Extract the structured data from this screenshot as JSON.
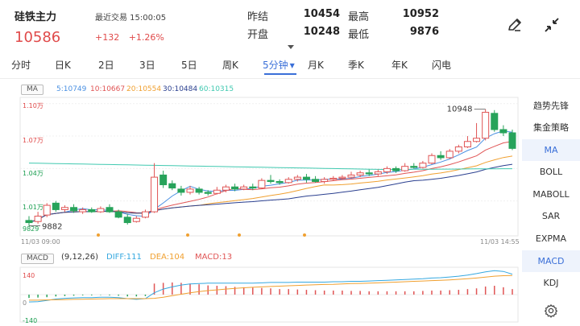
{
  "header": {
    "name": "硅铁主力",
    "last_trade": "最近交易 15:00:05",
    "price": "10586",
    "change": "+132",
    "change_pct": "+1.26%",
    "stats": [
      {
        "label": "昨结",
        "value": "10454"
      },
      {
        "label": "最高",
        "value": "10952"
      },
      {
        "label": "开盘",
        "value": "10248"
      },
      {
        "label": "最低",
        "value": "9876"
      }
    ]
  },
  "tabs": [
    {
      "label": "分时"
    },
    {
      "label": "日K"
    },
    {
      "label": "2日"
    },
    {
      "label": "3日"
    },
    {
      "label": "5日"
    },
    {
      "label": "周K"
    },
    {
      "label": "5分钟"
    },
    {
      "label": "月K"
    },
    {
      "label": "季K"
    },
    {
      "label": "年K"
    },
    {
      "label": "闪电"
    }
  ],
  "active_tab": "5分钟",
  "ma_legend": {
    "badge": "MA",
    "items": [
      {
        "label": "5:10749",
        "color": "#4a90e2"
      },
      {
        "label": "10:10667",
        "color": "#e05555"
      },
      {
        "label": "20:10554",
        "color": "#f0a030"
      },
      {
        "label": "30:10484",
        "color": "#2a3f8f"
      },
      {
        "label": "60:10315",
        "color": "#40c9b0"
      }
    ]
  },
  "price_axis": {
    "ticks": [
      {
        "label": "1.10万",
        "value": 11000,
        "color": "#e04a4a"
      },
      {
        "label": "1.07万",
        "value": 10700,
        "color": "#e04a4a"
      },
      {
        "label": "1.04万",
        "value": 10400,
        "color": "#1a9e50"
      },
      {
        "label": "1.01万",
        "value": 10100,
        "color": "#1a9e50"
      }
    ],
    "low_label": "9829",
    "max_annotation": "10948",
    "min_annotation": "9882",
    "time_start": "11/03 09:00",
    "time_end": "11/03 14:55"
  },
  "macd_legend": {
    "badge": "MACD",
    "params": "(9,12,26)",
    "diff": "DIFF:111",
    "dea": "DEA:104",
    "macd": "MACD:13",
    "colors": {
      "diff": "#35a8e0",
      "dea": "#f0a030",
      "macd": "#e05555"
    }
  },
  "macd_axis": {
    "ticks": [
      "140",
      "0",
      "-140"
    ]
  },
  "sidebar": [
    {
      "label": "趋势先锋"
    },
    {
      "label": "集金策略"
    },
    {
      "label": "MA"
    },
    {
      "label": "BOLL"
    },
    {
      "label": "MABOLL"
    },
    {
      "label": "SAR"
    },
    {
      "label": "EXPMA"
    },
    {
      "label": "MACD"
    },
    {
      "label": "KDJ"
    }
  ],
  "sidebar_active": [
    "MA",
    "MACD"
  ],
  "icons": {
    "edit": "pen-icon",
    "collapse": "collapse-arrows-icon",
    "settings": "gear-icon"
  },
  "chart_data": {
    "type": "candlestick",
    "y_range": [
      9800,
      11050
    ],
    "candles": [
      {
        "o": 9920,
        "c": 9900,
        "h": 9960,
        "l": 9870
      },
      {
        "o": 9910,
        "c": 9960,
        "h": 10000,
        "l": 9890
      },
      {
        "o": 9970,
        "c": 10060,
        "h": 10080,
        "l": 9950
      },
      {
        "o": 10080,
        "c": 10020,
        "h": 10100,
        "l": 10000
      },
      {
        "o": 10020,
        "c": 10040,
        "h": 10060,
        "l": 10000
      },
      {
        "o": 10040,
        "c": 10010,
        "h": 10070,
        "l": 9990
      },
      {
        "o": 10000,
        "c": 10020,
        "h": 10040,
        "l": 9980
      },
      {
        "o": 10020,
        "c": 10000,
        "h": 10040,
        "l": 9990
      },
      {
        "o": 10000,
        "c": 10030,
        "h": 10050,
        "l": 9990
      },
      {
        "o": 10040,
        "c": 10000,
        "h": 10070,
        "l": 9990
      },
      {
        "o": 10000,
        "c": 9950,
        "h": 10020,
        "l": 9940
      },
      {
        "o": 9950,
        "c": 9900,
        "h": 9980,
        "l": 9882
      },
      {
        "o": 9910,
        "c": 9940,
        "h": 9960,
        "l": 9900
      },
      {
        "o": 9950,
        "c": 10000,
        "h": 10020,
        "l": 9940
      },
      {
        "o": 10000,
        "c": 10320,
        "h": 10450,
        "l": 9990
      },
      {
        "o": 10340,
        "c": 10250,
        "h": 10380,
        "l": 10220
      },
      {
        "o": 10260,
        "c": 10220,
        "h": 10290,
        "l": 10200
      },
      {
        "o": 10210,
        "c": 10180,
        "h": 10240,
        "l": 10150
      },
      {
        "o": 10180,
        "c": 10210,
        "h": 10240,
        "l": 10160
      },
      {
        "o": 10210,
        "c": 10180,
        "h": 10230,
        "l": 10160
      },
      {
        "o": 10180,
        "c": 10170,
        "h": 10200,
        "l": 10150
      },
      {
        "o": 10170,
        "c": 10200,
        "h": 10230,
        "l": 10160
      },
      {
        "o": 10200,
        "c": 10230,
        "h": 10250,
        "l": 10180
      },
      {
        "o": 10230,
        "c": 10210,
        "h": 10260,
        "l": 10190
      },
      {
        "o": 10210,
        "c": 10230,
        "h": 10250,
        "l": 10200
      },
      {
        "o": 10230,
        "c": 10220,
        "h": 10260,
        "l": 10200
      },
      {
        "o": 10220,
        "c": 10290,
        "h": 10310,
        "l": 10210
      },
      {
        "o": 10290,
        "c": 10280,
        "h": 10340,
        "l": 10260
      },
      {
        "o": 10280,
        "c": 10270,
        "h": 10300,
        "l": 10250
      },
      {
        "o": 10270,
        "c": 10300,
        "h": 10320,
        "l": 10260
      },
      {
        "o": 10300,
        "c": 10320,
        "h": 10340,
        "l": 10280
      },
      {
        "o": 10320,
        "c": 10300,
        "h": 10350,
        "l": 10270
      },
      {
        "o": 10300,
        "c": 10280,
        "h": 10330,
        "l": 10270
      },
      {
        "o": 10280,
        "c": 10300,
        "h": 10320,
        "l": 10260
      },
      {
        "o": 10300,
        "c": 10310,
        "h": 10330,
        "l": 10290
      },
      {
        "o": 10310,
        "c": 10320,
        "h": 10340,
        "l": 10300
      },
      {
        "o": 10320,
        "c": 10340,
        "h": 10370,
        "l": 10310
      },
      {
        "o": 10340,
        "c": 10360,
        "h": 10380,
        "l": 10320
      },
      {
        "o": 10360,
        "c": 10350,
        "h": 10390,
        "l": 10330
      },
      {
        "o": 10350,
        "c": 10370,
        "h": 10390,
        "l": 10330
      },
      {
        "o": 10370,
        "c": 10400,
        "h": 10420,
        "l": 10350
      },
      {
        "o": 10400,
        "c": 10380,
        "h": 10420,
        "l": 10360
      },
      {
        "o": 10380,
        "c": 10420,
        "h": 10450,
        "l": 10370
      },
      {
        "o": 10420,
        "c": 10410,
        "h": 10450,
        "l": 10400
      },
      {
        "o": 10410,
        "c": 10450,
        "h": 10470,
        "l": 10400
      },
      {
        "o": 10450,
        "c": 10520,
        "h": 10540,
        "l": 10440
      },
      {
        "o": 10520,
        "c": 10500,
        "h": 10560,
        "l": 10480
      },
      {
        "o": 10500,
        "c": 10560,
        "h": 10580,
        "l": 10490
      },
      {
        "o": 10560,
        "c": 10600,
        "h": 10620,
        "l": 10540
      },
      {
        "o": 10600,
        "c": 10650,
        "h": 10700,
        "l": 10590
      },
      {
        "o": 10650,
        "c": 10680,
        "h": 10820,
        "l": 10640
      },
      {
        "o": 10680,
        "c": 10920,
        "h": 10948,
        "l": 10660
      },
      {
        "o": 10910,
        "c": 10760,
        "h": 10940,
        "l": 10740
      },
      {
        "o": 10760,
        "c": 10730,
        "h": 10800,
        "l": 10700
      },
      {
        "o": 10730,
        "c": 10586,
        "h": 10760,
        "l": 10570
      }
    ],
    "macd_range": [
      -140,
      140
    ],
    "macd_hist": [
      -18,
      -16,
      -14,
      -10,
      -8,
      -6,
      -4,
      -4,
      -2,
      -4,
      -6,
      -10,
      -10,
      -8,
      60,
      64,
      66,
      64,
      60,
      56,
      50,
      48,
      46,
      42,
      40,
      38,
      36,
      34,
      30,
      30,
      28,
      26,
      24,
      22,
      22,
      22,
      20,
      20,
      18,
      18,
      18,
      18,
      18,
      18,
      20,
      22,
      22,
      24,
      26,
      30,
      34,
      44,
      48,
      40,
      30
    ],
    "diff": [
      -40,
      -38,
      -32,
      -24,
      -20,
      -18,
      -16,
      -16,
      -14,
      -14,
      -16,
      -22,
      -26,
      -22,
      10,
      30,
      42,
      52,
      58,
      60,
      62,
      62,
      62,
      62,
      62,
      62,
      64,
      66,
      66,
      66,
      68,
      68,
      68,
      68,
      70,
      70,
      72,
      72,
      74,
      76,
      78,
      80,
      82,
      84,
      86,
      90,
      92,
      96,
      100,
      106,
      114,
      124,
      130,
      126,
      111
    ],
    "dea": [
      -30,
      -30,
      -29,
      -28,
      -27,
      -26,
      -25,
      -24,
      -23,
      -22,
      -22,
      -22,
      -22,
      -22,
      -20,
      -14,
      -6,
      2,
      10,
      16,
      22,
      26,
      30,
      34,
      37,
      40,
      42,
      44,
      46,
      48,
      50,
      52,
      54,
      55,
      56,
      58,
      60,
      61,
      62,
      64,
      66,
      68,
      70,
      72,
      74,
      76,
      78,
      80,
      83,
      86,
      90,
      95,
      100,
      103,
      104
    ]
  }
}
